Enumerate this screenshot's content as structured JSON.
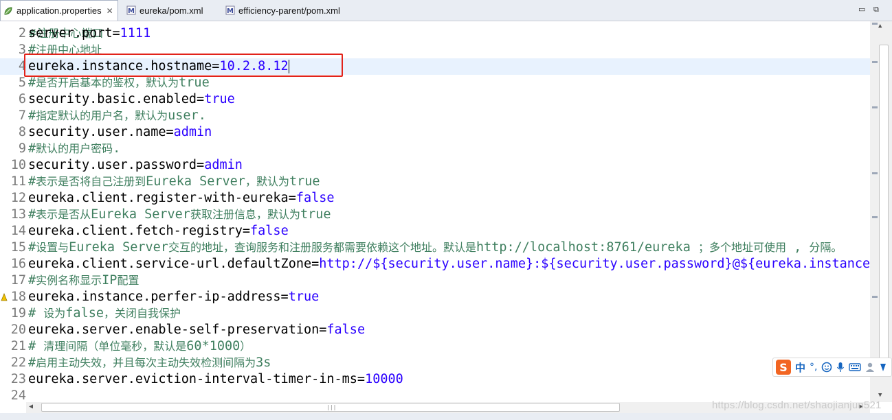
{
  "tabs": [
    {
      "label": "application.properties",
      "active": true,
      "icon": "properties-file-icon",
      "closable": true
    },
    {
      "label": "eureka/pom.xml",
      "active": false,
      "icon": "maven-pom-icon"
    },
    {
      "label": "efficiency-parent/pom.xml",
      "active": false,
      "icon": "maven-pom-icon"
    }
  ],
  "editor": {
    "partial_top_line": "#注册中心端口",
    "lines": [
      {
        "num": "2",
        "type": "prop",
        "key": "server.port=",
        "value": "1111"
      },
      {
        "num": "3",
        "type": "comment",
        "segs": [
          [
            "#",
            ""
          ],
          [
            "注册中心地址",
            "cn"
          ]
        ]
      },
      {
        "num": "4",
        "type": "prop",
        "key": "eureka.instance.hostname=",
        "value": "10.2.8.12",
        "current": true,
        "caret": true
      },
      {
        "num": "5",
        "type": "comment",
        "segs": [
          [
            "#",
            ""
          ],
          [
            "是否开启基本的鉴权，默认为",
            "cn"
          ],
          [
            "true",
            ""
          ]
        ]
      },
      {
        "num": "6",
        "type": "prop",
        "key": "security.basic.enabled=",
        "value": "true"
      },
      {
        "num": "7",
        "type": "comment",
        "segs": [
          [
            "#",
            ""
          ],
          [
            "指定默认的用户名，默认为",
            "cn"
          ],
          [
            "user.",
            ""
          ]
        ]
      },
      {
        "num": "8",
        "type": "prop",
        "key": "security.user.name=",
        "value": "admin"
      },
      {
        "num": "9",
        "type": "comment",
        "segs": [
          [
            "#",
            ""
          ],
          [
            "默认的用户密码",
            "cn"
          ],
          [
            ".",
            ""
          ]
        ]
      },
      {
        "num": "10",
        "type": "prop",
        "key": "security.user.password=",
        "value": "admin"
      },
      {
        "num": "11",
        "type": "comment",
        "segs": [
          [
            "#",
            ""
          ],
          [
            "表示是否将自己注册到",
            "cn"
          ],
          [
            "Eureka Server",
            ""
          ],
          [
            "，默认为",
            "cn"
          ],
          [
            "true",
            ""
          ]
        ]
      },
      {
        "num": "12",
        "type": "prop",
        "key": "eureka.client.register-with-eureka=",
        "value": "false"
      },
      {
        "num": "13",
        "type": "comment",
        "segs": [
          [
            "#",
            ""
          ],
          [
            "表示是否从",
            "cn"
          ],
          [
            "Eureka Server",
            ""
          ],
          [
            "获取注册信息，默认为",
            "cn"
          ],
          [
            "true",
            ""
          ]
        ]
      },
      {
        "num": "14",
        "type": "prop",
        "key": "eureka.client.fetch-registry=",
        "value": "false"
      },
      {
        "num": "15",
        "type": "comment",
        "segs": [
          [
            "#",
            ""
          ],
          [
            "设置与",
            "cn"
          ],
          [
            "Eureka Server",
            ""
          ],
          [
            "交互的地址，查询服务和注册服务都需要依赖这个地址。默认是",
            "cn"
          ],
          [
            "http://localhost:8761/eureka ",
            ""
          ],
          [
            "；多个地址可使用",
            "cn"
          ],
          [
            " , ",
            ""
          ],
          [
            "分隔。",
            "cn"
          ]
        ]
      },
      {
        "num": "16",
        "type": "prop",
        "key": "eureka.client.service-url.defaultZone=",
        "value": "http://${security.user.name}:${security.user.password}@${eureka.instance.hostname}:${server.port}/eureka/"
      },
      {
        "num": "17",
        "type": "comment",
        "segs": [
          [
            "#",
            ""
          ],
          [
            "实例名称显示",
            "cn"
          ],
          [
            "IP",
            ""
          ],
          [
            "配置",
            "cn"
          ]
        ]
      },
      {
        "num": "18",
        "type": "prop",
        "key": "eureka.instance.perfer-ip-address=",
        "value": "true",
        "warning": true
      },
      {
        "num": "19",
        "type": "comment",
        "segs": [
          [
            "# ",
            ""
          ],
          [
            "设为",
            "cn"
          ],
          [
            "false",
            ""
          ],
          [
            "，关闭自我保护",
            "cn"
          ]
        ]
      },
      {
        "num": "20",
        "type": "prop",
        "key": "eureka.server.enable-self-preservation=",
        "value": "false"
      },
      {
        "num": "21",
        "type": "comment",
        "segs": [
          [
            "# ",
            ""
          ],
          [
            "清理间隔（单位毫秒，默认是",
            "cn"
          ],
          [
            "60*1000",
            ""
          ],
          [
            "）",
            "cn"
          ]
        ]
      },
      {
        "num": "22",
        "type": "comment",
        "segs": [
          [
            "#",
            ""
          ],
          [
            "启用主动失效，并且每次主动失效检测间隔为",
            "cn"
          ],
          [
            "3s",
            ""
          ]
        ]
      },
      {
        "num": "23",
        "type": "prop",
        "key": "eureka.server.eviction-interval-timer-in-ms=",
        "value": "10000"
      },
      {
        "num": "24",
        "type": "empty"
      }
    ]
  },
  "ime": {
    "logo": "S",
    "mode": "中",
    "punct": "°,",
    "icons": [
      "emoji-icon",
      "microphone-icon",
      "keyboard-icon",
      "skin-icon",
      "toolbox-icon"
    ]
  },
  "watermark": "https://blog.csdn.net/shaojianjun521",
  "colors": {
    "value": "#2a00ff",
    "comment": "#3f7f5f",
    "current_line": "#e8f2fe",
    "highlight_box": "#e2231a"
  }
}
